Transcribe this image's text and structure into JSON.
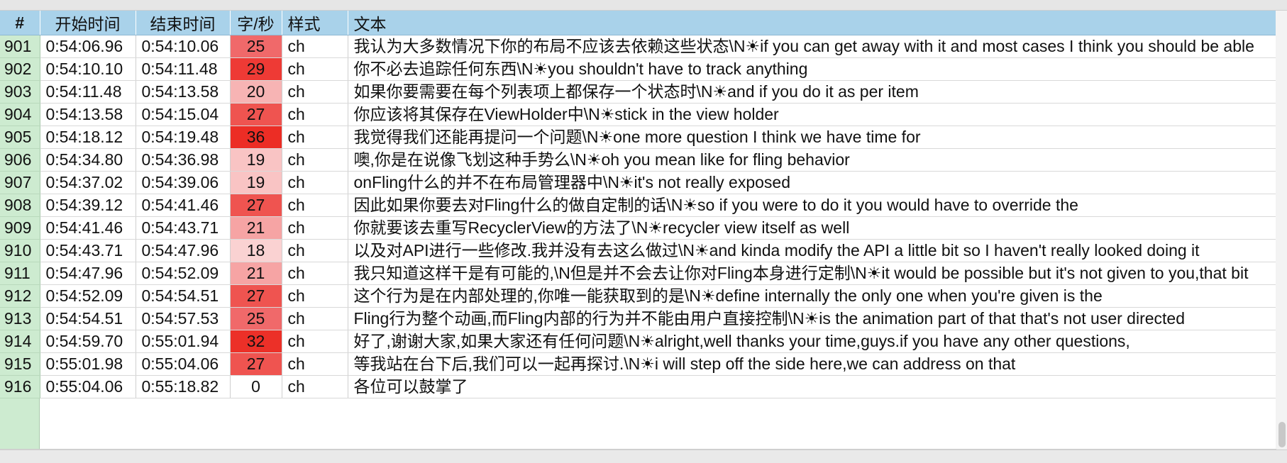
{
  "table": {
    "headers": {
      "num": "#",
      "start": "开始时间",
      "end": "结束时间",
      "cps": "字/秒",
      "style": "样式",
      "text": "文本"
    },
    "rows": [
      {
        "num": "901",
        "start": "0:54:06.96",
        "end": "0:54:10.06",
        "cps": "25",
        "cps_color": "#f0696a",
        "style": "ch",
        "text": "我认为大多数情况下你的布局不应该去依赖这些状态\\N☀if you can get away with it and most cases I think you should be able"
      },
      {
        "num": "902",
        "start": "0:54:10.10",
        "end": "0:54:11.48",
        "cps": "29",
        "cps_color": "#ee3a35",
        "style": "ch",
        "text": "你不必去追踪任何东西\\N☀you shouldn't have to track anything"
      },
      {
        "num": "903",
        "start": "0:54:11.48",
        "end": "0:54:13.58",
        "cps": "20",
        "cps_color": "#f7b4b4",
        "style": "ch",
        "text": "如果你要需要在每个列表项上都保存一个状态时\\N☀and if you do it as per item"
      },
      {
        "num": "904",
        "start": "0:54:13.58",
        "end": "0:54:15.04",
        "cps": "27",
        "cps_color": "#ef5450",
        "style": "ch",
        "text": "你应该将其保存在ViewHolder中\\N☀stick in the view holder"
      },
      {
        "num": "905",
        "start": "0:54:18.12",
        "end": "0:54:19.48",
        "cps": "36",
        "cps_color": "#ec2d25",
        "style": "ch",
        "text": "我觉得我们还能再提问一个问题\\N☀one more question I think we have time for"
      },
      {
        "num": "906",
        "start": "0:54:34.80",
        "end": "0:54:36.98",
        "cps": "19",
        "cps_color": "#f9c4c4",
        "style": "ch",
        "text": "噢,你是在说像飞划这种手势么\\N☀oh you mean like for fling behavior"
      },
      {
        "num": "907",
        "start": "0:54:37.02",
        "end": "0:54:39.06",
        "cps": "19",
        "cps_color": "#f9c4c4",
        "style": "ch",
        "text": "onFling什么的并不在布局管理器中\\N☀it's not really exposed"
      },
      {
        "num": "908",
        "start": "0:54:39.12",
        "end": "0:54:41.46",
        "cps": "27",
        "cps_color": "#ef5450",
        "style": "ch",
        "text": "因此如果你要去对Fling什么的做自定制的话\\N☀so if you were to do it you would have to override the"
      },
      {
        "num": "909",
        "start": "0:54:41.46",
        "end": "0:54:43.71",
        "cps": "21",
        "cps_color": "#f6a4a4",
        "style": "ch",
        "text": "你就要该去重写RecyclerView的方法了\\N☀recycler view itself as well"
      },
      {
        "num": "910",
        "start": "0:54:43.71",
        "end": "0:54:47.96",
        "cps": "18",
        "cps_color": "#fad2d2",
        "style": "ch",
        "text": "以及对API进行一些修改.我并没有去这么做过\\N☀and kinda modify the API a little bit so I haven't really looked doing it"
      },
      {
        "num": "911",
        "start": "0:54:47.96",
        "end": "0:54:52.09",
        "cps": "21",
        "cps_color": "#f6a4a4",
        "style": "ch",
        "text": "我只知道这样干是有可能的,\\N但是并不会去让你对Fling本身进行定制\\N☀it would be possible but it's not given to you,that bit"
      },
      {
        "num": "912",
        "start": "0:54:52.09",
        "end": "0:54:54.51",
        "cps": "27",
        "cps_color": "#ef5450",
        "style": "ch",
        "text": "这个行为是在内部处理的,你唯一能获取到的是\\N☀define internally the only one when you're given is the"
      },
      {
        "num": "913",
        "start": "0:54:54.51",
        "end": "0:54:57.53",
        "cps": "25",
        "cps_color": "#f0696a",
        "style": "ch",
        "text": "Fling行为整个动画,而Fling内部的行为并不能由用户直接控制\\N☀is the animation part of that that's not user directed"
      },
      {
        "num": "914",
        "start": "0:54:59.70",
        "end": "0:55:01.94",
        "cps": "32",
        "cps_color": "#ec3028",
        "style": "ch",
        "text": "好了,谢谢大家,如果大家还有任何问题\\N☀alright,well thanks your time,guys.if you have any other questions,"
      },
      {
        "num": "915",
        "start": "0:55:01.98",
        "end": "0:55:04.06",
        "cps": "27",
        "cps_color": "#ef5450",
        "style": "ch",
        "text": "等我站在台下后,我们可以一起再探讨.\\N☀i will step off the side here,we can address on that"
      },
      {
        "num": "916",
        "start": "0:55:04.06",
        "end": "0:55:18.82",
        "cps": "0",
        "cps_color": "#ffffff",
        "style": "ch",
        "text": "各位可以鼓掌了"
      }
    ]
  }
}
